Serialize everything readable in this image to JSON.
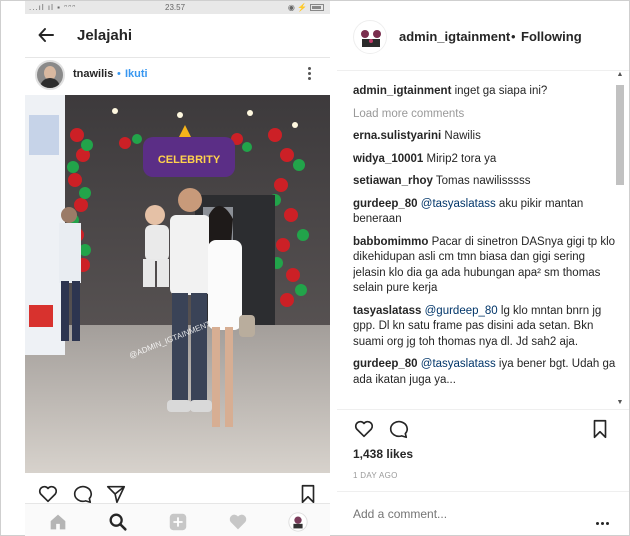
{
  "statusbar": {
    "left": "...ıl ıl ▪ ᵔᵔᵔ",
    "time": "23.57",
    "right": "◉ ⚡"
  },
  "phone": {
    "title": "Jelajahi",
    "post": {
      "username": "tnawilis",
      "separator": "•",
      "follow": "Ikuti"
    },
    "photo_watermark": "@ADMIN_IGTAINMENT",
    "icons": {
      "back": "arrow-left-icon",
      "more": "more-vertical-icon",
      "like": "heart-icon",
      "comment": "comment-bubble-icon",
      "share": "send-icon",
      "save": "bookmark-icon",
      "nav": [
        "home-icon",
        "search-icon",
        "add-icon",
        "activity-heart-icon",
        "profile-icon"
      ]
    }
  },
  "panel": {
    "username": "admin_igtainment",
    "separator": "•",
    "following": "Following",
    "caption": {
      "user": "admin_igtainment",
      "text": "inget ga siapa ini?"
    },
    "load_more": "Load more comments",
    "comments": [
      {
        "user": "erna.sulistyarini",
        "mention": "",
        "text": "Nawilis"
      },
      {
        "user": "widya_10001",
        "mention": "",
        "text": "Mirip2 tora ya"
      },
      {
        "user": "setiawan_rhoy",
        "mention": "",
        "text": "Tomas nawilisssss"
      },
      {
        "user": "gurdeep_80",
        "mention": "@tasyaslatass",
        "text": "aku pikir mantan beneraan"
      },
      {
        "user": "babbomimmo",
        "mention": "",
        "text": "Pacar di sinetron DASnya gigi tp klo dikehidupan asli cm tmn biasa dan gigi sering jelasin klo dia ga ada hubungan apa² sm thomas selain pure kerja"
      },
      {
        "user": "tasyaslatass",
        "mention": "@gurdeep_80",
        "text": "lg klo mntan bnrn jg gpp. Dl kn satu frame pas disini ada setan. Bkn suami org jg toh thomas nya dl. Jd sah2 aja."
      },
      {
        "user": "gurdeep_80",
        "mention": "@tasyaslatass",
        "text": "iya bener bgt. Udah ga ada ikatan juga ya..."
      }
    ],
    "likes": "1,438 likes",
    "time": "1 DAY AGO",
    "add_comment_placeholder": "Add a comment...",
    "icons": {
      "like": "heart-icon",
      "comment": "comment-bubble-icon",
      "save": "bookmark-icon",
      "more": "more-horizontal-icon"
    }
  },
  "colors": {
    "link": "#3897f0",
    "text": "#262626",
    "muted": "#999999"
  }
}
